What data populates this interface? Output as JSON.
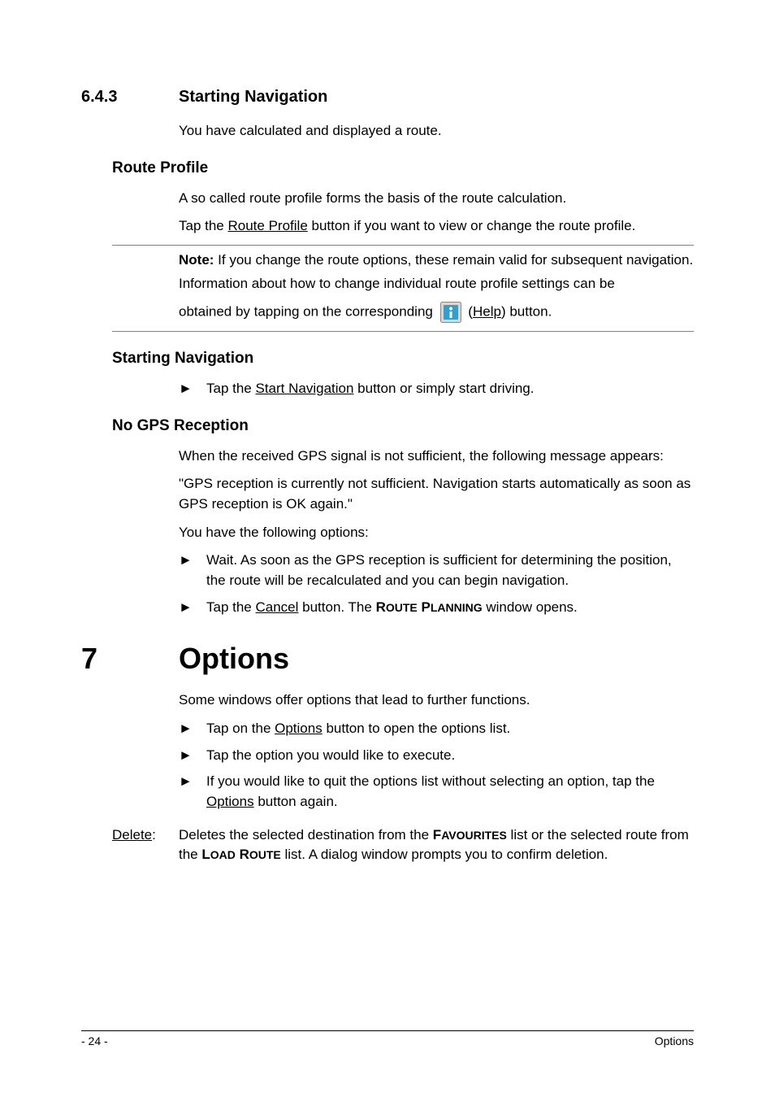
{
  "s643": {
    "num": "6.4.3",
    "title": "Starting Navigation",
    "intro": "You have calculated and displayed a route."
  },
  "routeProfile": {
    "heading": "Route Profile",
    "p1": "A so called route profile forms the basis of the route calculation.",
    "p2_pre": "Tap the ",
    "p2_link": "Route Profile",
    "p2_post": " button if you want to view or change the route profile.",
    "note_label": "Note:",
    "note_body": " If you change the route options, these remain valid for subsequent navigation.",
    "note_p2": "Information about how to change individual route profile settings can be",
    "note_p3_pre": "obtained by tapping on the corresponding ",
    "note_p3_link": "Help",
    "note_p3_paren_open": " (",
    "note_p3_paren_close": ") button."
  },
  "startNav": {
    "heading": "Starting Navigation",
    "bullet_pre": "Tap the ",
    "bullet_link": "Start Navigation",
    "bullet_post": " button or simply start driving."
  },
  "noGps": {
    "heading": "No GPS Reception",
    "p1": "When the received GPS signal is not sufficient, the following message appears:",
    "p2": "\"GPS reception is currently not sufficient. Navigation starts automatically as soon as GPS reception is OK again.\"",
    "p3": "You have the following options:",
    "b1": "Wait. As soon as the GPS reception is sufficient for determining the position, the route will be recalculated and you can begin navigation.",
    "b2_pre": "Tap the ",
    "b2_link": "Cancel",
    "b2_mid": " button. The ",
    "b2_sc1": "R",
    "b2_sc2": "OUTE",
    "b2_sc3": " P",
    "b2_sc4": "LANNING",
    "b2_post": " window opens."
  },
  "chapter7": {
    "num": "7",
    "title": "Options",
    "p1": "Some windows offer options that lead to further functions.",
    "b1_pre": "Tap on the ",
    "b1_link": "Options",
    "b1_post": " button to open the options list.",
    "b2": "Tap the option you would like to execute.",
    "b3_pre": "If you would like to quit the options list without selecting an option, tap the ",
    "b3_link": "Options",
    "b3_post": " button again.",
    "def_term": "Delete",
    "def_sep": ":",
    "def_body_pre": "Deletes the selected destination from the ",
    "def_fav1": "F",
    "def_fav2": "AVOURITES",
    "def_body_mid": " list or the selected route from the ",
    "def_lr1": "L",
    "def_lr2": "OAD",
    "def_lr3": " R",
    "def_lr4": "OUTE",
    "def_body_post": " list. A dialog window prompts you to confirm deletion."
  },
  "footer": {
    "page": "- 24 -",
    "section": "Options"
  },
  "bullet_glyph": "►"
}
